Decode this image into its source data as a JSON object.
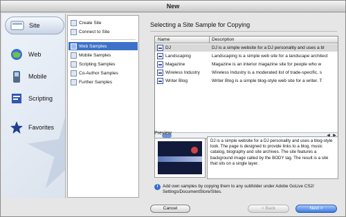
{
  "window": {
    "title": "New"
  },
  "categories": [
    {
      "label": "Site",
      "icon": "site-icon"
    },
    {
      "label": "Web",
      "icon": "web-globe-icon"
    },
    {
      "label": "Mobile",
      "icon": "mobile-phone-icon"
    },
    {
      "label": "Scripting",
      "icon": "scripting-icon"
    },
    {
      "label": "Favorites",
      "icon": "favorites-star-icon"
    }
  ],
  "list": {
    "top": [
      "Create Site",
      "Connect to Site"
    ],
    "samples": [
      "Web Samples",
      "Mobile Samples",
      "Scripting Samples",
      "Co-Author Samples",
      "Further Samples"
    ],
    "selected": "Web Samples"
  },
  "panel": {
    "heading": "Selecting a Site Sample for Copying",
    "columns": {
      "name": "Name",
      "description": "Description"
    },
    "rows": [
      {
        "name": "DJ",
        "description": "DJ is a simple website for a DJ personality and uses a bl"
      },
      {
        "name": "Landscaping",
        "description": "Landscaping is a simple web site for a landscape architect"
      },
      {
        "name": "Magazine",
        "description": "Magazine is an interior magazine site for people who w"
      },
      {
        "name": "Wireless Industry",
        "description": "Wireless Industry is a moderated list of trade-specific, s"
      },
      {
        "name": "Writer Blog",
        "description": "Writer Blog is a simple blog-style web site for a writer. T"
      }
    ],
    "preview_label": "Preview",
    "preview_text": "DJ is a simple website for a DJ personality and uses a blog-style look. The page is designed to provide links to a blog, music catalog, biography and site archives. The site features a background image called by the BODY tag. The result is a site that sits on a single layer.",
    "info_text": "Add own samples by copying them to any subfolder under Adobe GoLive CS2/ Settings/DocumentStore/Sites."
  },
  "buttons": {
    "cancel": "Cancel",
    "back": "< Back",
    "next": "Next >"
  },
  "colors": {
    "selection": "#3e72c8",
    "default_button": "#3d7ae0"
  }
}
